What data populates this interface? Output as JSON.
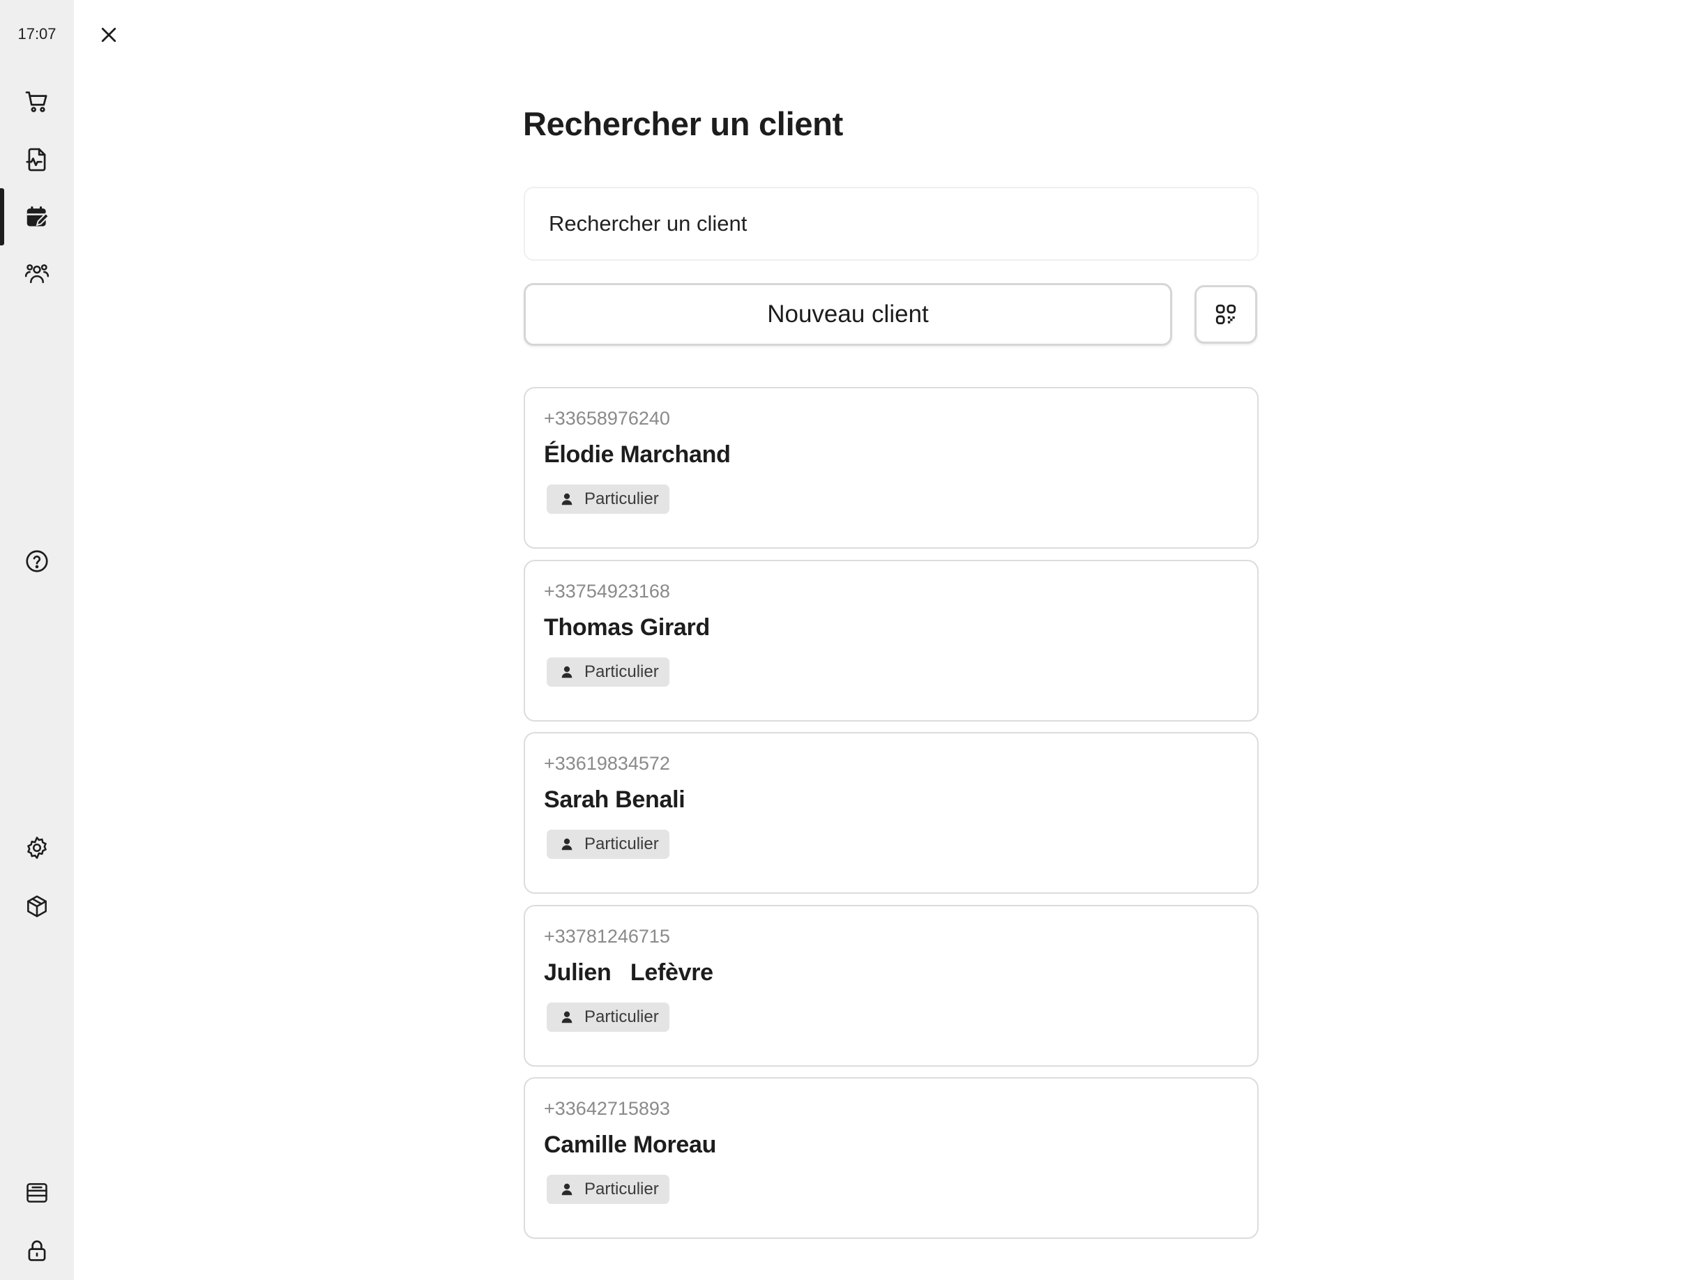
{
  "status_bar": {
    "time": "17:07"
  },
  "sidebar": {
    "items": [
      {
        "name": "cart",
        "icon": "cart-icon",
        "active": false
      },
      {
        "name": "sales",
        "icon": "document-chart-icon",
        "active": false
      },
      {
        "name": "appointments",
        "icon": "calendar-edit-icon",
        "active": true
      },
      {
        "name": "customers",
        "icon": "users-icon",
        "active": false
      },
      {
        "name": "help",
        "icon": "help-circle-icon",
        "active": false
      },
      {
        "name": "settings",
        "icon": "gear-icon",
        "active": false
      },
      {
        "name": "products",
        "icon": "box-icon",
        "active": false
      },
      {
        "name": "cash-register",
        "icon": "register-icon",
        "active": false
      },
      {
        "name": "lock",
        "icon": "lock-icon",
        "active": false
      }
    ]
  },
  "header": {
    "close_icon": "close-icon"
  },
  "page": {
    "title": "Rechercher un client",
    "search_placeholder": "Rechercher un client",
    "new_client_label": "Nouveau client",
    "qr_icon": "qr-code-icon"
  },
  "clients": [
    {
      "phone": "+33658976240",
      "name": "Élodie Marchand",
      "type": "Particulier"
    },
    {
      "phone": "+33754923168",
      "name": "Thomas Girard",
      "type": "Particulier"
    },
    {
      "phone": "+33619834572",
      "name": "Sarah Benali",
      "type": "Particulier"
    },
    {
      "phone": "+33781246715",
      "name": "Julien   Lefèvre",
      "type": "Particulier"
    },
    {
      "phone": "+33642715893",
      "name": "Camille Moreau",
      "type": "Particulier"
    }
  ],
  "colors": {
    "rail_bg": "#efefef",
    "text": "#1d1d1d",
    "muted": "#8a8a8a",
    "badge_bg": "#e4e4e4",
    "border": "#dcdcdc"
  }
}
